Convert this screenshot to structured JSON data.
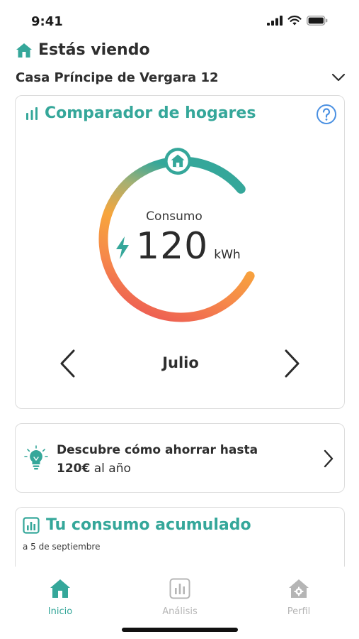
{
  "status_bar": {
    "time": "9:41"
  },
  "header": {
    "watching_label": "Estás viendo",
    "address": "Casa Príncipe de Vergara 12"
  },
  "comparator": {
    "title": "Comparador de hogares",
    "consumo_label": "Consumo",
    "value": "120",
    "unit": "kWh",
    "month": "Julio",
    "gauge_fill_fraction": 0.82
  },
  "tip": {
    "line1": "Descubre cómo ahorrar hasta",
    "amount": "120€",
    "line2_rest": " al año"
  },
  "accumulated": {
    "title": "Tu consumo acumulado",
    "subtitle": "a 5 de septiembre"
  },
  "tabs": [
    {
      "label": "Inicio",
      "active": true
    },
    {
      "label": "Análisis",
      "active": false
    },
    {
      "label": "Perfil",
      "active": false
    }
  ],
  "colors": {
    "accent": "#35a79a",
    "inactive": "#b5b5b5",
    "gauge_red": "#ea4f57",
    "gauge_orange": "#f7a53c"
  },
  "icons": {
    "header": "home-icon",
    "comparator": "bar-chart-icon",
    "help": "help-icon",
    "tip": "lightbulb-icon",
    "accumulated": "chart-box-icon"
  }
}
